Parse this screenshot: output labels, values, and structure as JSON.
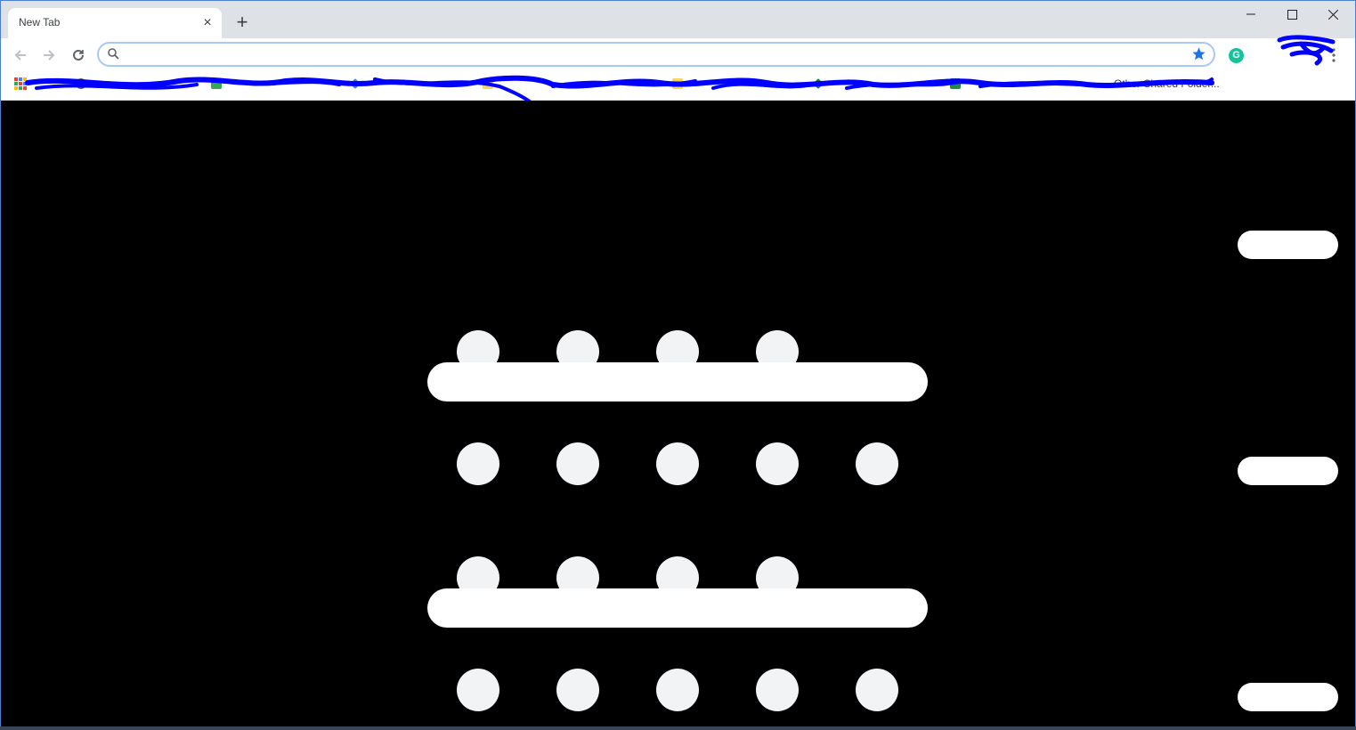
{
  "browser": {
    "tab": {
      "title": "New Tab",
      "close_glyph": "×"
    },
    "new_tab_glyph": "+",
    "window_controls": [
      "minimize-icon",
      "maximize-icon",
      "close-icon"
    ],
    "omnibox": {
      "value": "",
      "placeholder": ""
    },
    "extensions": [
      {
        "name": "grammarly-icon",
        "glyph": "G",
        "color": "#15c39a"
      }
    ],
    "bookmarks_visible_text": [
      "Other Shared Folder..."
    ]
  },
  "colors": {
    "page_background": "#000000",
    "tab_strip": "#dee1e6",
    "accent_blue": "#1a73e8",
    "placeholder_fill": "#f1f3f4",
    "redaction_ink": "#0000ff"
  }
}
